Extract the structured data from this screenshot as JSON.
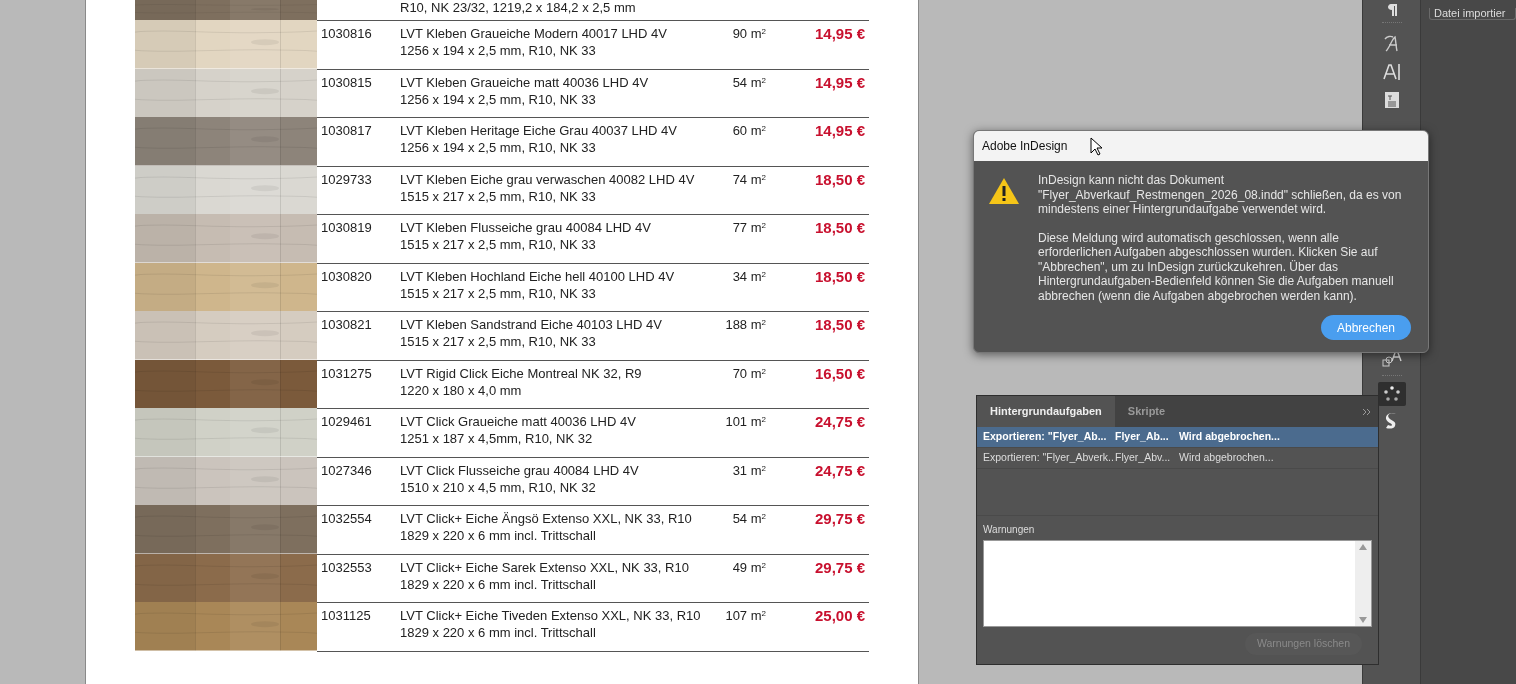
{
  "document": {
    "top_row": {
      "line2": "R10, NK 23/32, 1219,2 x 184,2 x 2,5 mm"
    },
    "rows": [
      {
        "article": "1030816",
        "name": "LVT Kleben Graueiche Modern 40017 LHD 4V",
        "spec": "1256 x 194 x 2,5 mm, R10, NK 33",
        "qty": "90 m$^{2}$",
        "price": "14,95 €"
      },
      {
        "article": "1030815",
        "name": "LVT Kleben Graueiche matt 40036 LHD 4V",
        "spec": "1256 x 194 x 2,5 mm, R10, NK 33",
        "qty": "54 m$^{2}$",
        "price": "14,95 €"
      },
      {
        "article": "1030817",
        "name": "LVT Kleben Heritage Eiche Grau 40037 LHD 4V",
        "spec": "1256 x 194 x 2,5 mm, R10, NK 33",
        "qty": "60 m$^{2}$",
        "price": "14,95 €"
      },
      {
        "article": "1029733",
        "name": "LVT Kleben Eiche grau verwaschen 40082 LHD 4V",
        "spec": "1515 x 217 x 2,5 mm, R10, NK 33",
        "qty": "74 m$^{2}$",
        "price": "18,50 €"
      },
      {
        "article": "1030819",
        "name": "LVT Kleben Flusseiche grau 40084 LHD 4V",
        "spec": "1515 x 217 x 2,5 mm, R10, NK 33",
        "qty": "77 m$^{2}$",
        "price": "18,50 €"
      },
      {
        "article": "1030820",
        "name": "LVT Kleben Hochland Eiche hell 40100 LHD 4V",
        "spec": "1515 x 217 x 2,5 mm, R10, NK 33",
        "qty": "34 m$^{2}$",
        "price": "18,50 €"
      },
      {
        "article": "1030821",
        "name": "LVT Kleben Sandstrand Eiche 40103 LHD 4V",
        "spec": "1515 x 217 x 2,5 mm, R10, NK 33",
        "qty": "188 m$^{2}$",
        "price": "18,50 €"
      },
      {
        "article": "1031275",
        "name": "LVT Rigid Click Eiche Montreal NK 32, R9",
        "spec": "1220 x 180 x 4,0 mm",
        "qty": "70 m$^{2}$",
        "price": "16,50 €"
      },
      {
        "article": "1029461",
        "name": "LVT Click Graueiche matt 40036 LHD 4V",
        "spec": "1251 x 187 x 4,5mm, R10, NK 32",
        "qty": "101 m$^{2}$",
        "price": "24,75 €"
      },
      {
        "article": "1027346",
        "name": "LVT Click Flusseiche grau 40084 LHD 4V",
        "spec": "1510 x 210 x 4,5 mm, R10, NK 32",
        "qty": "31 m$^{2}$",
        "price": "24,75 €"
      },
      {
        "article": "1032554",
        "name": "LVT Click+ Eiche Ängsö Extenso XXL, NK 33, R10",
        "spec": "1829 x 220 x 6 mm incl. Trittschall",
        "qty": "54 m$^{2}$",
        "price": "29,75 €"
      },
      {
        "article": "1032553",
        "name": "LVT Click+ Eiche Sarek Extenso XXL, NK 33, R10",
        "spec": "1829 x 220 x 6 mm incl. Trittschall",
        "qty": "49 m$^{2}$",
        "price": "29,75 €"
      },
      {
        "article": "1031125",
        "name": "LVT Click+ Eiche Tiveden Extenso XXL, NK 33, R10",
        "spec": "1829 x 220 x 6 mm incl. Trittschall",
        "qty": "107 m$^{2}$",
        "price": "25,00 €"
      }
    ]
  },
  "dialog": {
    "title": "Adobe InDesign",
    "paragraphs": [
      "InDesign kann nicht das Dokument \"Flyer_Abverkauf_Restmengen_2026_08.indd\" schließen, da es von mindestens einer Hintergrundaufgabe verwendet wird.",
      "Diese Meldung wird automatisch geschlossen, wenn alle erforderlichen Aufgaben abgeschlossen wurden. Klicken Sie auf \"Abbrechen\", um zu InDesign zurückzukehren. Über das Hintergrundaufgaben-Bedienfeld können Sie die Aufgaben manuell abbrechen (wenn die Aufgaben abgebrochen werden kann)."
    ],
    "button": "Abbrechen"
  },
  "tasks_panel": {
    "tabs": [
      {
        "label": "Hintergrundaufgaben",
        "selected": true
      },
      {
        "label": "Skripte",
        "selected": false
      }
    ],
    "tasks": [
      {
        "task": "Exportieren: \"Flyer_Ab...",
        "document": "Flyer_Ab...",
        "status": "Wird abgebrochen...",
        "selected": true
      },
      {
        "task": "Exportieren: \"Flyer_Abverk...",
        "document": "Flyer_Abv...",
        "status": "Wird abgebrochen...",
        "selected": false
      }
    ],
    "warnings_label": "Warnungen",
    "clear_button": {
      "label": "Warnungen löschen",
      "disabled": true
    }
  },
  "side_panel": {
    "button": "Datei importier"
  }
}
